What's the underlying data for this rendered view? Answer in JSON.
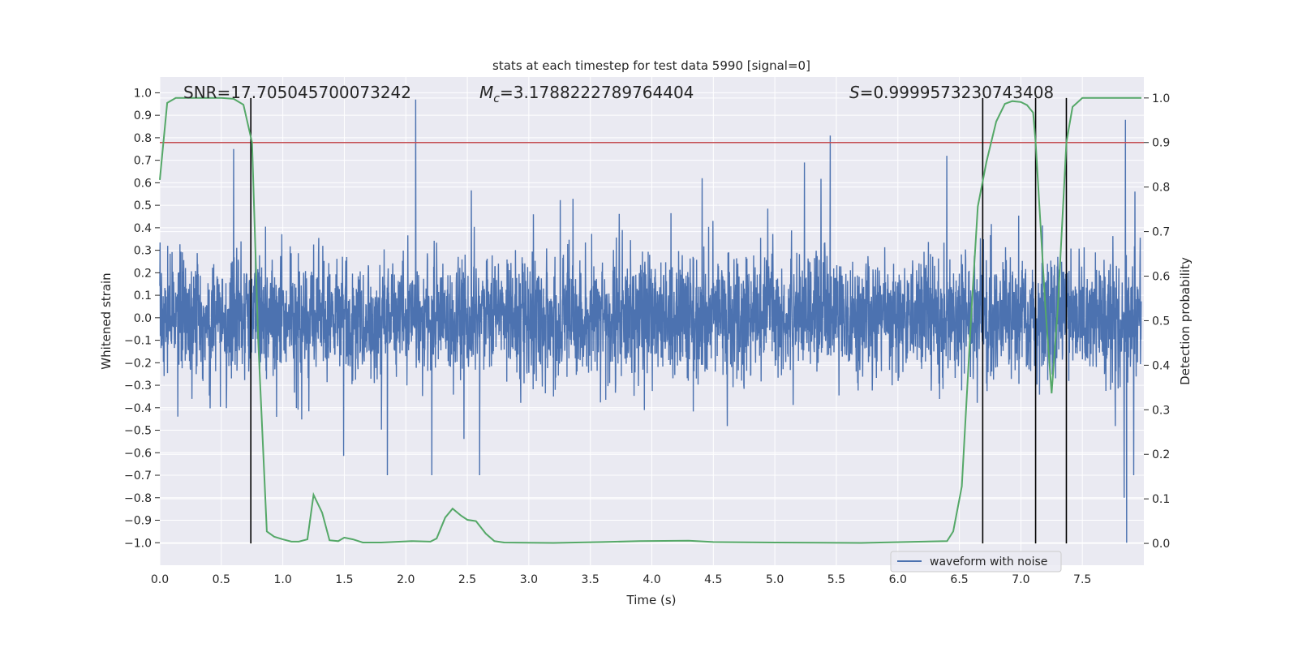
{
  "chart_data": {
    "type": "line",
    "title": "stats at each timestep for test data 5990 [signal=0]",
    "xlabel": "Time (s)",
    "ylabel": "Whitened strain",
    "y2label": "Detection probability",
    "xlim": [
      0,
      8.0
    ],
    "ylim": [
      -1.1,
      1.07
    ],
    "y2lim": [
      -0.049,
      1.047
    ],
    "grid": true,
    "x_ticks": [
      "0.0",
      "0.5",
      "1.0",
      "1.5",
      "2.0",
      "2.5",
      "3.0",
      "3.5",
      "4.0",
      "4.5",
      "5.0",
      "5.5",
      "6.0",
      "6.5",
      "7.0",
      "7.5"
    ],
    "y_ticks": [
      "1.0",
      "0.9",
      "0.8",
      "0.7",
      "0.6",
      "0.5",
      "0.4",
      "0.3",
      "0.2",
      "0.1",
      "0.0",
      "-0.1",
      "-0.2",
      "-0.3",
      "-0.4",
      "-0.5",
      "-0.6",
      "-0.7",
      "-0.8",
      "-0.9",
      "-1.0"
    ],
    "y2_ticks": [
      "1.0",
      "0.9",
      "0.8",
      "0.7",
      "0.6",
      "0.5",
      "0.4",
      "0.3",
      "0.2",
      "0.1",
      "0.0"
    ],
    "annotations": {
      "snr": "SNR=17.705045700073242",
      "mc_symbol": "M",
      "mc_sub": "c",
      "mc_value": "=3.1788222789764404",
      "s_symbol": "S",
      "s_value": "=0.9999573230743408"
    },
    "legend": {
      "position": "lower-right",
      "entries": [
        "waveform with noise"
      ]
    },
    "colors": {
      "waveform": "#4c72b0",
      "probability": "#55a868",
      "threshold": "#c44e52",
      "markers": "#000000",
      "background": "#eaeaf2"
    },
    "waveform_noise": {
      "typical_range": [
        -0.35,
        0.35
      ],
      "notable_peaks": [
        [
          0.6,
          0.75
        ],
        [
          2.08,
          0.97
        ],
        [
          5.45,
          0.81
        ],
        [
          7.85,
          0.88
        ],
        [
          7.86,
          -1.0
        ],
        [
          7.84,
          -0.8
        ],
        [
          1.85,
          -0.7
        ],
        [
          2.6,
          -0.7
        ]
      ]
    },
    "threshold": 0.9,
    "detection_markers": [
      0.74,
      6.69,
      7.12,
      7.37
    ],
    "probability_series": {
      "x": [
        0,
        0.06,
        0.13,
        0.3,
        0.5,
        0.6,
        0.68,
        0.75,
        0.8,
        0.87,
        0.93,
        1.0,
        1.07,
        1.13,
        1.2,
        1.25,
        1.32,
        1.38,
        1.45,
        1.5,
        1.57,
        1.65,
        1.8,
        2.05,
        2.2,
        2.25,
        2.32,
        2.38,
        2.45,
        2.5,
        2.57,
        2.65,
        2.72,
        2.8,
        3.2,
        3.6,
        3.9,
        4.3,
        4.5,
        5.0,
        5.7,
        6.4,
        6.45,
        6.52,
        6.6,
        6.65,
        6.72,
        6.8,
        6.87,
        6.93,
        7.0,
        7.05,
        7.1,
        7.12,
        7.2,
        7.25,
        7.3,
        7.37,
        7.42,
        7.5,
        7.98
      ],
      "y": [
        0.816,
        0.989,
        1.0,
        1.0,
        1.0,
        0.998,
        0.985,
        0.9,
        0.455,
        0.027,
        0.015,
        0.009,
        0.004,
        0.004,
        0.009,
        0.109,
        0.069,
        0.007,
        0.005,
        0.013,
        0.009,
        0.002,
        0.002,
        0.005,
        0.004,
        0.011,
        0.058,
        0.078,
        0.062,
        0.053,
        0.05,
        0.022,
        0.005,
        0.002,
        0.001,
        0.003,
        0.005,
        0.006,
        0.003,
        0.002,
        0.001,
        0.005,
        0.027,
        0.128,
        0.528,
        0.756,
        0.856,
        0.947,
        0.987,
        0.993,
        0.991,
        0.984,
        0.967,
        0.9,
        0.528,
        0.337,
        0.528,
        0.9,
        0.98,
        1.0,
        1.0
      ]
    }
  }
}
